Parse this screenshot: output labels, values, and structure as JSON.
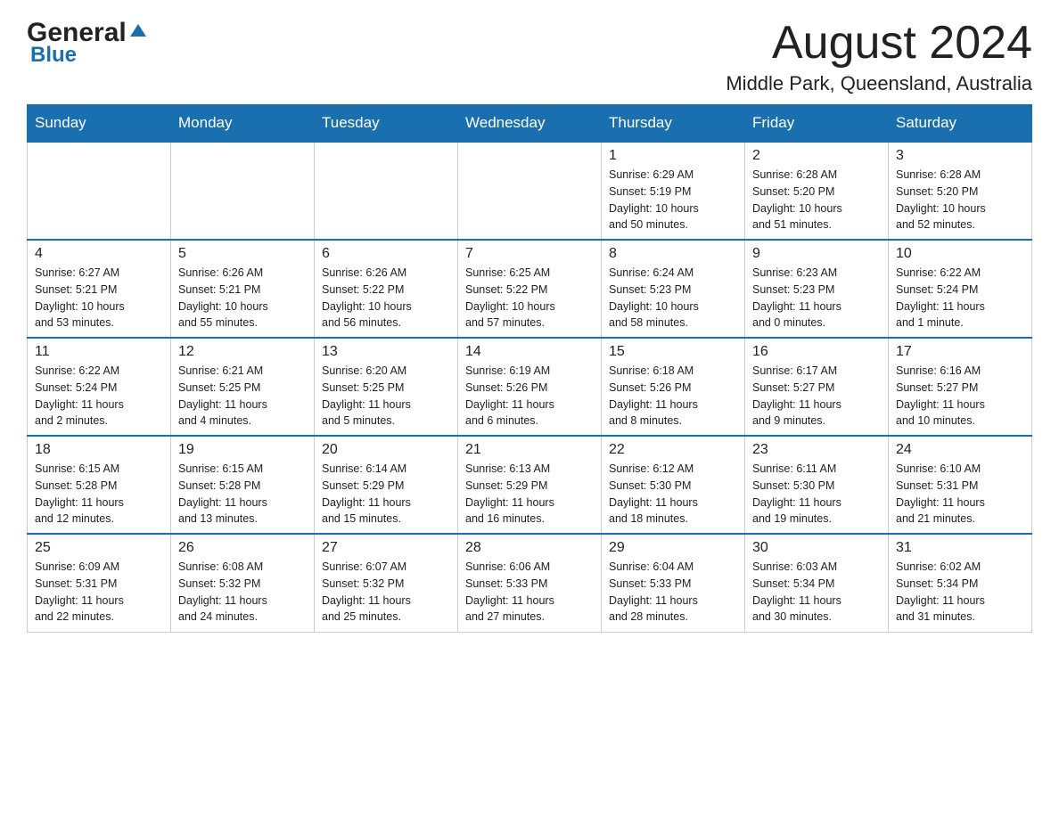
{
  "header": {
    "logo_general": "General",
    "logo_blue": "Blue",
    "month_title": "August 2024",
    "location": "Middle Park, Queensland, Australia"
  },
  "days_of_week": [
    "Sunday",
    "Monday",
    "Tuesday",
    "Wednesday",
    "Thursday",
    "Friday",
    "Saturday"
  ],
  "weeks": [
    {
      "days": [
        {
          "number": "",
          "info": ""
        },
        {
          "number": "",
          "info": ""
        },
        {
          "number": "",
          "info": ""
        },
        {
          "number": "",
          "info": ""
        },
        {
          "number": "1",
          "info": "Sunrise: 6:29 AM\nSunset: 5:19 PM\nDaylight: 10 hours\nand 50 minutes."
        },
        {
          "number": "2",
          "info": "Sunrise: 6:28 AM\nSunset: 5:20 PM\nDaylight: 10 hours\nand 51 minutes."
        },
        {
          "number": "3",
          "info": "Sunrise: 6:28 AM\nSunset: 5:20 PM\nDaylight: 10 hours\nand 52 minutes."
        }
      ]
    },
    {
      "days": [
        {
          "number": "4",
          "info": "Sunrise: 6:27 AM\nSunset: 5:21 PM\nDaylight: 10 hours\nand 53 minutes."
        },
        {
          "number": "5",
          "info": "Sunrise: 6:26 AM\nSunset: 5:21 PM\nDaylight: 10 hours\nand 55 minutes."
        },
        {
          "number": "6",
          "info": "Sunrise: 6:26 AM\nSunset: 5:22 PM\nDaylight: 10 hours\nand 56 minutes."
        },
        {
          "number": "7",
          "info": "Sunrise: 6:25 AM\nSunset: 5:22 PM\nDaylight: 10 hours\nand 57 minutes."
        },
        {
          "number": "8",
          "info": "Sunrise: 6:24 AM\nSunset: 5:23 PM\nDaylight: 10 hours\nand 58 minutes."
        },
        {
          "number": "9",
          "info": "Sunrise: 6:23 AM\nSunset: 5:23 PM\nDaylight: 11 hours\nand 0 minutes."
        },
        {
          "number": "10",
          "info": "Sunrise: 6:22 AM\nSunset: 5:24 PM\nDaylight: 11 hours\nand 1 minute."
        }
      ]
    },
    {
      "days": [
        {
          "number": "11",
          "info": "Sunrise: 6:22 AM\nSunset: 5:24 PM\nDaylight: 11 hours\nand 2 minutes."
        },
        {
          "number": "12",
          "info": "Sunrise: 6:21 AM\nSunset: 5:25 PM\nDaylight: 11 hours\nand 4 minutes."
        },
        {
          "number": "13",
          "info": "Sunrise: 6:20 AM\nSunset: 5:25 PM\nDaylight: 11 hours\nand 5 minutes."
        },
        {
          "number": "14",
          "info": "Sunrise: 6:19 AM\nSunset: 5:26 PM\nDaylight: 11 hours\nand 6 minutes."
        },
        {
          "number": "15",
          "info": "Sunrise: 6:18 AM\nSunset: 5:26 PM\nDaylight: 11 hours\nand 8 minutes."
        },
        {
          "number": "16",
          "info": "Sunrise: 6:17 AM\nSunset: 5:27 PM\nDaylight: 11 hours\nand 9 minutes."
        },
        {
          "number": "17",
          "info": "Sunrise: 6:16 AM\nSunset: 5:27 PM\nDaylight: 11 hours\nand 10 minutes."
        }
      ]
    },
    {
      "days": [
        {
          "number": "18",
          "info": "Sunrise: 6:15 AM\nSunset: 5:28 PM\nDaylight: 11 hours\nand 12 minutes."
        },
        {
          "number": "19",
          "info": "Sunrise: 6:15 AM\nSunset: 5:28 PM\nDaylight: 11 hours\nand 13 minutes."
        },
        {
          "number": "20",
          "info": "Sunrise: 6:14 AM\nSunset: 5:29 PM\nDaylight: 11 hours\nand 15 minutes."
        },
        {
          "number": "21",
          "info": "Sunrise: 6:13 AM\nSunset: 5:29 PM\nDaylight: 11 hours\nand 16 minutes."
        },
        {
          "number": "22",
          "info": "Sunrise: 6:12 AM\nSunset: 5:30 PM\nDaylight: 11 hours\nand 18 minutes."
        },
        {
          "number": "23",
          "info": "Sunrise: 6:11 AM\nSunset: 5:30 PM\nDaylight: 11 hours\nand 19 minutes."
        },
        {
          "number": "24",
          "info": "Sunrise: 6:10 AM\nSunset: 5:31 PM\nDaylight: 11 hours\nand 21 minutes."
        }
      ]
    },
    {
      "days": [
        {
          "number": "25",
          "info": "Sunrise: 6:09 AM\nSunset: 5:31 PM\nDaylight: 11 hours\nand 22 minutes."
        },
        {
          "number": "26",
          "info": "Sunrise: 6:08 AM\nSunset: 5:32 PM\nDaylight: 11 hours\nand 24 minutes."
        },
        {
          "number": "27",
          "info": "Sunrise: 6:07 AM\nSunset: 5:32 PM\nDaylight: 11 hours\nand 25 minutes."
        },
        {
          "number": "28",
          "info": "Sunrise: 6:06 AM\nSunset: 5:33 PM\nDaylight: 11 hours\nand 27 minutes."
        },
        {
          "number": "29",
          "info": "Sunrise: 6:04 AM\nSunset: 5:33 PM\nDaylight: 11 hours\nand 28 minutes."
        },
        {
          "number": "30",
          "info": "Sunrise: 6:03 AM\nSunset: 5:34 PM\nDaylight: 11 hours\nand 30 minutes."
        },
        {
          "number": "31",
          "info": "Sunrise: 6:02 AM\nSunset: 5:34 PM\nDaylight: 11 hours\nand 31 minutes."
        }
      ]
    }
  ]
}
